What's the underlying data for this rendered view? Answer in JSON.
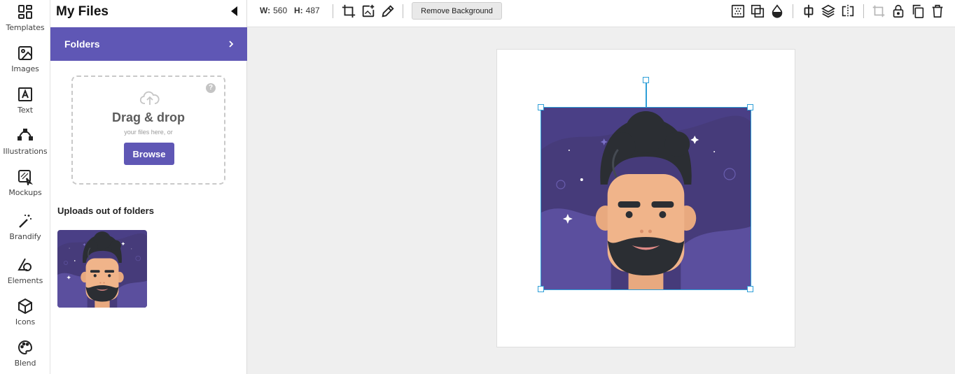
{
  "rail": {
    "items": [
      {
        "label": "Templates",
        "icon": "templates-icon"
      },
      {
        "label": "Images",
        "icon": "image-icon"
      },
      {
        "label": "Text",
        "icon": "text-icon"
      },
      {
        "label": "Illustrations",
        "icon": "illustrations-icon"
      },
      {
        "label": "Mockups",
        "icon": "mockups-icon"
      },
      {
        "label": "Brandify",
        "icon": "magic-wand-icon"
      },
      {
        "label": "Elements",
        "icon": "shapes-icon"
      },
      {
        "label": "Icons",
        "icon": "cube-icon"
      },
      {
        "label": "Blend",
        "icon": "palette-icon"
      }
    ]
  },
  "panel": {
    "title": "My Files",
    "folders_label": "Folders",
    "drop": {
      "title": "Drag & drop",
      "subtitle": "your files here, or",
      "browse_label": "Browse",
      "help": "?"
    },
    "uploads_title": "Uploads out of folders"
  },
  "toolbar": {
    "width_label": "W:",
    "width_value": "560",
    "height_label": "H:",
    "height_value": "487",
    "remove_bg_label": "Remove Background"
  },
  "colors": {
    "accent": "#5f57b5",
    "selection": "#2e9fd8",
    "avatar_bg": "#4a3f86",
    "skin": "#f0b48a",
    "hair": "#2b2e33"
  }
}
